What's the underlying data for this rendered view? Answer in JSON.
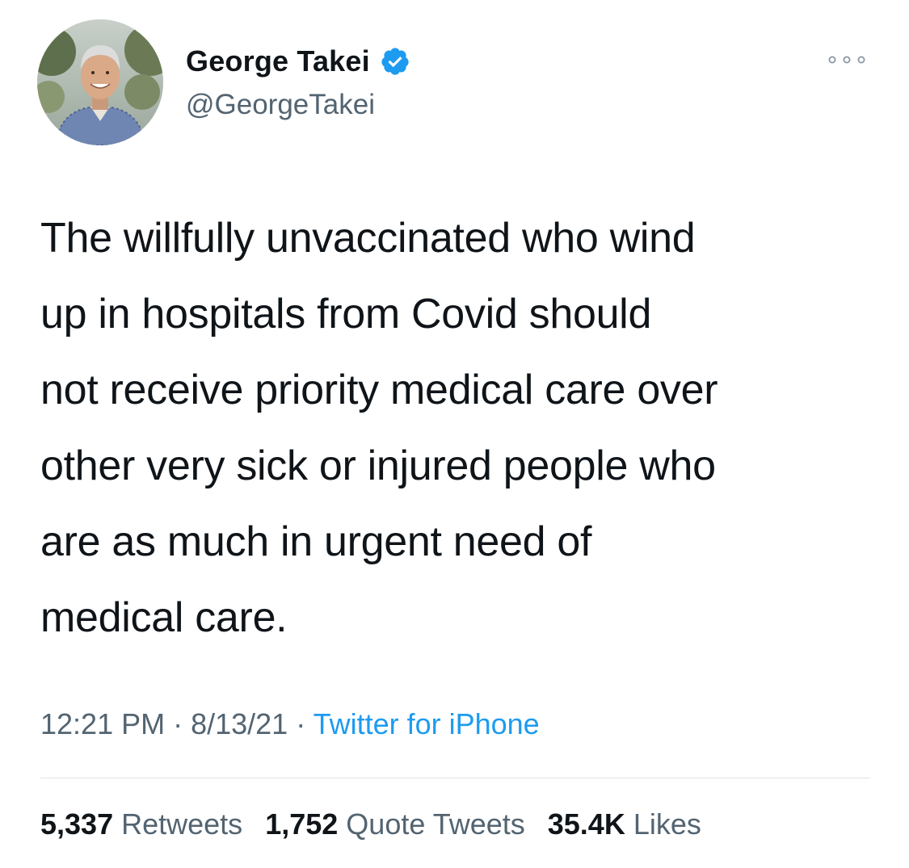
{
  "author": {
    "display_name": "George Takei",
    "handle": "@GeorgeTakei",
    "verified": true,
    "avatar_icon": "profile-photo"
  },
  "tweet": {
    "text": "The willfully unvaccinated who wind\nup in hospitals from Covid should\nnot receive priority medical care over\nother very sick or injured people who\nare as much in urgent need of\nmedical care."
  },
  "meta": {
    "time": "12:21 PM",
    "sep1": " · ",
    "date": "8/13/21",
    "sep2": " · ",
    "source": "Twitter for iPhone"
  },
  "stats": {
    "retweets_count": "5,337",
    "retweets_label": "Retweets",
    "quotes_count": "1,752",
    "quotes_label": "Quote Tweets",
    "likes_count": "35.4K",
    "likes_label": "Likes"
  },
  "colors": {
    "text": "#0f1419",
    "secondary": "#536471",
    "accent": "#1d9bf0"
  }
}
